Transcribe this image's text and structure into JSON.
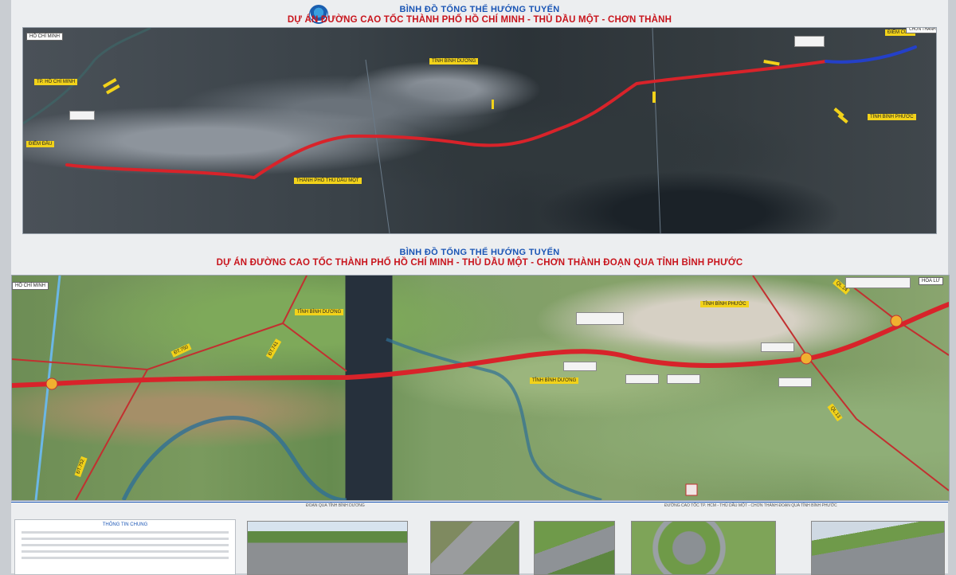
{
  "panel_top": {
    "title": "BÌNH ĐỒ TỔNG THỂ HƯỚNG TUYẾN",
    "subtitle": "DỰ ÁN ĐƯỜNG CAO TỐC THÀNH PHỐ HỒ CHÍ MINH - THỦ DẦU MỘT - CHƠN THÀNH",
    "labels": {
      "ho_chi_minh": "HỒ CHÍ MINH",
      "tp_ho_chi_minh": "TP. HỒ CHÍ MINH",
      "tinh_binh_duong": "TỈNH BÌNH DƯƠNG",
      "tinh_binh_phuoc": "TỈNH BÌNH PHƯỚC",
      "diem_dau": "ĐIỂM ĐẦU",
      "diem_cuoi": "ĐIỂM CUỐI",
      "thanh_pho_thu_dau_mot": "THÀNH PHỐ THỦ DẦU MỘT",
      "chon_thanh": "CHƠN THÀNH"
    }
  },
  "panel_bottom": {
    "title": "BÌNH ĐỒ TỔNG THỂ HƯỚNG TUYẾN",
    "subtitle": "DỰ ÁN ĐƯỜNG CAO TỐC THÀNH PHỐ HỒ CHÍ MINH - THỦ DẦU MỘT - CHƠN THÀNH ĐOẠN QUA TỈNH BÌNH PHƯỚC",
    "labels": {
      "ho_chi_minh": "HỒ CHÍ MINH",
      "tinh_binh_duong_1": "TỈNH BÌNH DƯƠNG",
      "tinh_binh_duong_2": "TỈNH BÌNH DƯƠNG",
      "tinh_binh_phuoc": "TỈNH BÌNH PHƯỚC",
      "hoa_lu": "HOA LƯ",
      "dt_750": "ĐT.750",
      "dt_741": "ĐT.741",
      "dt_752": "ĐT.752",
      "ql_13": "QL.13",
      "ql_14": "QL.14"
    }
  },
  "bottom_strip": {
    "section_caption_1": "ĐOẠN QUA TỈNH BÌNH DƯƠNG",
    "section_caption_2": "ĐƯỜNG CAO TỐC TP. HCM - THỦ DẦU MỘT - CHƠN THÀNH ĐOẠN QUA TỈNH BÌNH PHƯỚC",
    "info_heading": "THÔNG TIN CHUNG"
  },
  "colors": {
    "route_red": "#d8232a",
    "route_blue": "#2440c8",
    "label_yellow": "#f2d21a",
    "title_blue": "#1a55b5",
    "title_red": "#c8141c"
  }
}
